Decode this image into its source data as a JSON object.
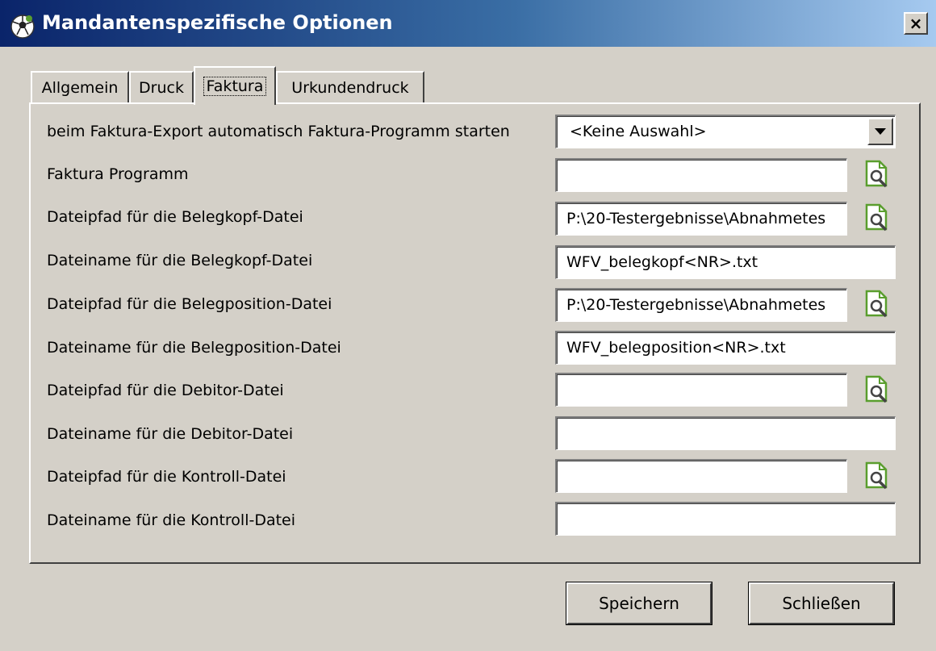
{
  "window": {
    "title": "Mandantenspezifische Optionen",
    "close_label": "×"
  },
  "tabs": [
    {
      "label": "Allgemein",
      "active": false
    },
    {
      "label": "Druck",
      "active": false
    },
    {
      "label": "Faktura",
      "active": true
    },
    {
      "label": "Urkundendruck",
      "active": false
    }
  ],
  "form": {
    "autostart": {
      "label": "beim Faktura-Export automatisch Faktura-Programm starten",
      "value": "<Keine Auswahl>"
    },
    "program": {
      "label": "Faktura Programm",
      "value": ""
    },
    "head_path": {
      "label": "Dateipfad für die Belegkopf-Datei",
      "value": "P:\\20-Testergebnisse\\Abnahmetes"
    },
    "head_name": {
      "label": "Dateiname für die Belegkopf-Datei",
      "value": "WFV_belegkopf<NR>.txt"
    },
    "pos_path": {
      "label": "Dateipfad für die Belegposition-Datei",
      "value": "P:\\20-Testergebnisse\\Abnahmetes"
    },
    "pos_name": {
      "label": "Dateiname für die Belegposition-Datei",
      "value": "WFV_belegposition<NR>.txt"
    },
    "debitor_path": {
      "label": "Dateipfad für die Debitor-Datei",
      "value": ""
    },
    "debitor_name": {
      "label": "Dateiname für die Debitor-Datei",
      "value": ""
    },
    "control_path": {
      "label": "Dateipfad für die Kontroll-Datei",
      "value": ""
    },
    "control_name": {
      "label": "Dateiname für die Kontroll-Datei",
      "value": ""
    }
  },
  "buttons": {
    "save": "Speichern",
    "close": "Schließen"
  },
  "icons": {
    "browse": "file-search-icon",
    "app": "soccer-ball-icon"
  },
  "colors": {
    "titlebar_start": "#0a246a",
    "titlebar_end": "#a6caf0",
    "dialog_bg": "#d4d0c8",
    "icon_green": "#5a9e2e"
  }
}
